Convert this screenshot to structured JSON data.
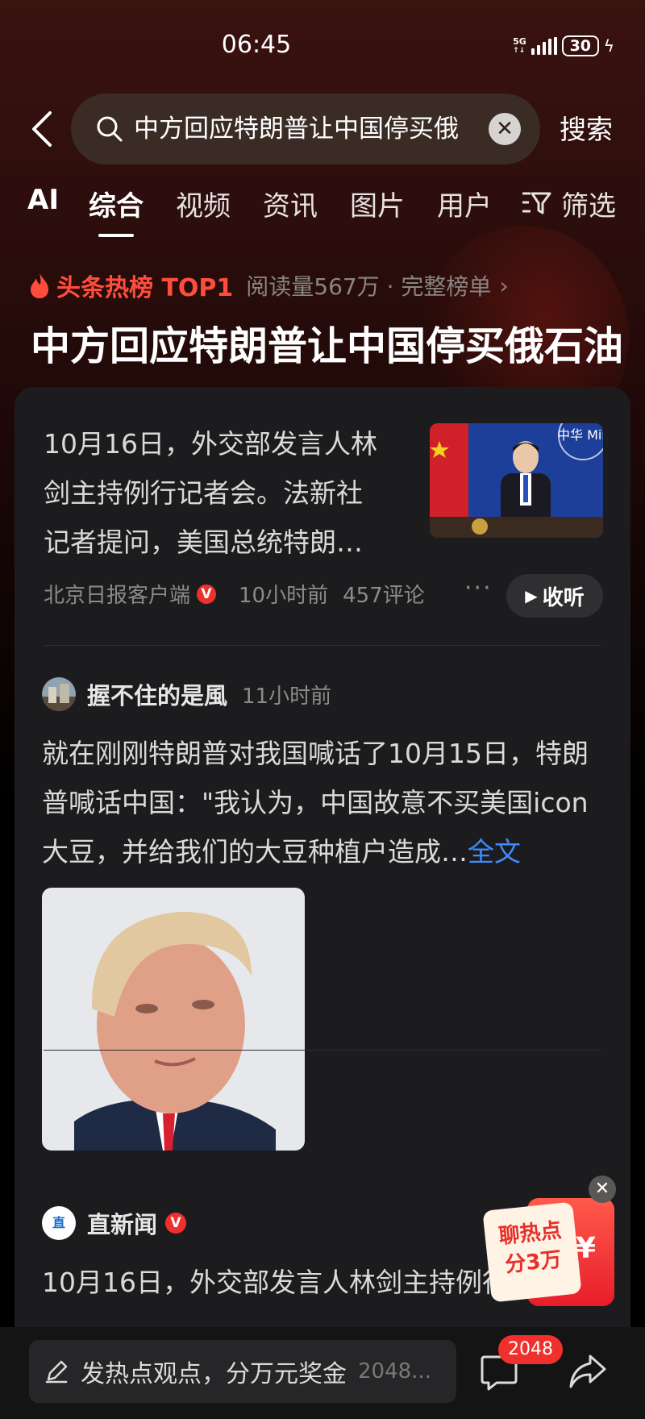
{
  "status_bar": {
    "time": "06:45",
    "network": "5G",
    "battery": "30"
  },
  "search": {
    "query": "中方回应特朗普让中国停买俄",
    "submit_label": "搜索"
  },
  "tabs": [
    "AI",
    "综合",
    "视频",
    "资讯",
    "图片",
    "用户"
  ],
  "active_tab": "综合",
  "filter_label": "筛选",
  "hot": {
    "label": "头条热榜 TOP1",
    "meta": "阅读量567万 · 完整榜单",
    "title": "中方回应特朗普让中国停买俄石油"
  },
  "news_item": {
    "text": "10月16日，外交部发言人林剑主持例行记者会。法新社记者提问，美国总统特朗…",
    "source": "北京日报客户端",
    "verified_mark": "V",
    "time": "10小时前",
    "comments": "457评论",
    "more": "···",
    "listen_label": "收听",
    "thumb_caption": "中华 Minis"
  },
  "post": {
    "author": "握不住的是風",
    "time": "11小时前",
    "text": "就在刚刚特朗普对我国喊话了10月15日，特朗普喊话中国：\"我认为，中国故意不买美国icon大豆，并给我们的大豆种植户造成…",
    "read_more": "全文"
  },
  "post2": {
    "author": "直新闻",
    "logo_text": "直",
    "verified_mark": "V",
    "text": "10月16日，外交部发言人林剑主持例行"
  },
  "promo": {
    "line1": "聊热点",
    "line2": "分3万",
    "yen": "¥",
    "close": "✕"
  },
  "bottom": {
    "placeholder": "发热点观点，分万元奖金",
    "count_inline": "2048...",
    "comment_badge": "2048"
  },
  "colors": {
    "accent_red": "#ff4d3d",
    "link_blue": "#3d8bff",
    "card_bg": "#1c1c1e"
  }
}
